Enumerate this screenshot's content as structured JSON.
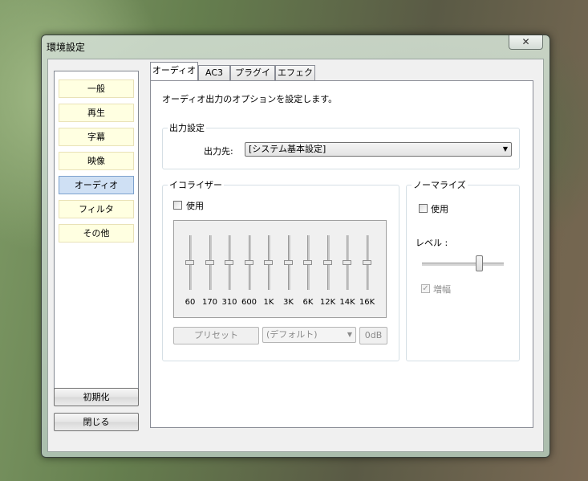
{
  "window": {
    "title": "環境設定",
    "close_glyph": "✕"
  },
  "sidebar": {
    "items": [
      {
        "label": "一般"
      },
      {
        "label": "再生"
      },
      {
        "label": "字幕"
      },
      {
        "label": "映像"
      },
      {
        "label": "オーディオ",
        "selected": true
      },
      {
        "label": "フィルタ"
      },
      {
        "label": "その他"
      }
    ],
    "reset_label": "初期化",
    "close_label": "閉じる"
  },
  "tabs": [
    {
      "label": "オーディオ",
      "active": true
    },
    {
      "label": "AC3"
    },
    {
      "label": "プラグイン"
    },
    {
      "label": "エフェクト"
    }
  ],
  "audio": {
    "description": "オーディオ出力のオプションを設定します。",
    "output": {
      "group_label": "出力設定",
      "field_label": "出力先:",
      "selected": "[システム基本設定]"
    },
    "equalizer": {
      "group_label": "イコライザー",
      "enable_label": "使用",
      "enabled": false,
      "bands": [
        {
          "label": "60",
          "level": 0.5
        },
        {
          "label": "170",
          "level": 0.5
        },
        {
          "label": "310",
          "level": 0.5
        },
        {
          "label": "600",
          "level": 0.5
        },
        {
          "label": "1K",
          "level": 0.5
        },
        {
          "label": "3K",
          "level": 0.5
        },
        {
          "label": "6K",
          "level": 0.5
        },
        {
          "label": "12K",
          "level": 0.5
        },
        {
          "label": "14K",
          "level": 0.5
        },
        {
          "label": "16K",
          "level": 0.5
        }
      ],
      "preset_button": "プリセット",
      "preset_selected": "(デフォルト)",
      "db_button": "0dB"
    },
    "normalize": {
      "group_label": "ノーマライズ",
      "enable_label": "使用",
      "enabled": false,
      "level_label": "レベル :",
      "level": 0.7,
      "amplify_label": "増幅",
      "amplify_checked": true
    }
  }
}
